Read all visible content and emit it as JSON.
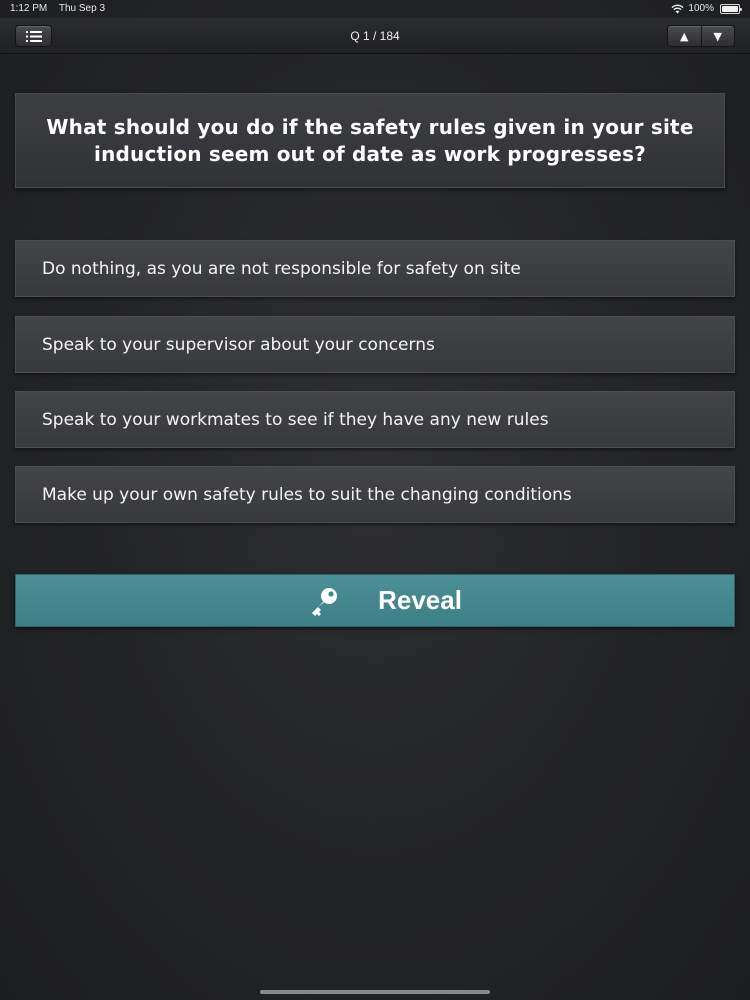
{
  "status_bar": {
    "time": "1:12 PM",
    "date": "Thu Sep 3",
    "battery": "100%"
  },
  "nav": {
    "title": "Q 1 / 184",
    "menu_icon": "list-icon",
    "up_icon": "arrow-up-icon",
    "down_icon": "arrow-down-icon"
  },
  "question": {
    "text": "What should you do if the safety rules given in your site induction seem out of date as work progresses?"
  },
  "answers": [
    {
      "label": "Do nothing, as you are not responsible for safety on site"
    },
    {
      "label": "Speak to your supervisor about your concerns"
    },
    {
      "label": "Speak to your workmates to see if they have any new rules"
    },
    {
      "label": "Make up your own safety rules to suit the changing conditions"
    }
  ],
  "reveal": {
    "label": "Reveal",
    "icon": "key-icon",
    "color": "#45878f"
  }
}
